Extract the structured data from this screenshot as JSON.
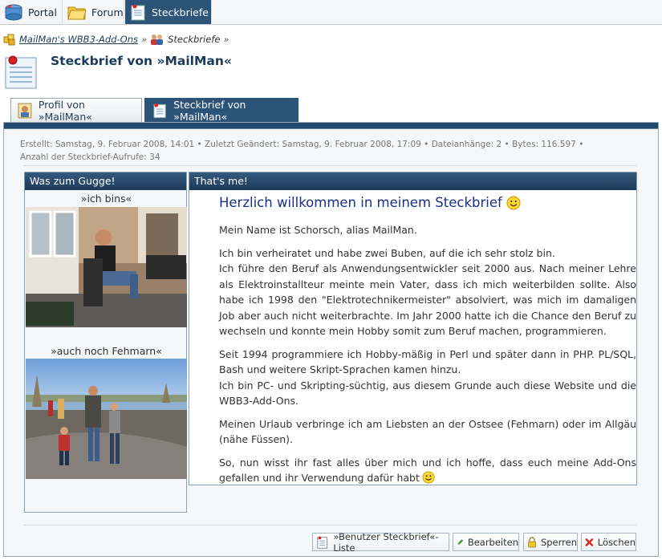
{
  "nav": {
    "tabs": [
      {
        "label": "Portal",
        "icon": "portal-icon"
      },
      {
        "label": "Forum",
        "icon": "forum-folder-icon"
      },
      {
        "label": "Steckbriefe",
        "icon": "steckbrief-icon",
        "active": true
      }
    ]
  },
  "breadcrumb": {
    "items": [
      {
        "label": "MailMan's WBB3-Add-Ons",
        "icon": "addons-icon",
        "link": true
      },
      {
        "label": "Steckbriefe",
        "icon": "users-icon",
        "link": false
      }
    ],
    "separator": "»"
  },
  "header": {
    "title": "Steckbrief von »MailMan«",
    "icon": "steckbrief-large-icon"
  },
  "subtabs": [
    {
      "label": "Profil von »MailMan«",
      "icon": "profile-icon",
      "active": false
    },
    {
      "label": "Steckbrief von »MailMan«",
      "icon": "steckbrief-icon",
      "active": true
    }
  ],
  "meta": "Erstellt: Samstag, 9. Februar 2008, 14:01 • Zuletzt Geändert: Samstag, 9. Februar 2008, 17:09 • Dateianhänge: 2 • Bytes: 116.597 • Anzahl der Steckbrief-Aufrufe: 34",
  "left_panel": {
    "title": "Was zum Gugge!",
    "captions": [
      "»ich bins«",
      "»auch noch Fehmarn«"
    ]
  },
  "right_panel": {
    "title": "That's me!",
    "heading": "Herzlich willkommen in meinem Steckbrief",
    "paragraphs": [
      "Mein Name ist Schorsch, alias MailMan.",
      "Ich bin verheiratet und habe zwei Buben, auf die ich sehr stolz bin.",
      "Ich führe den Beruf als Anwendungsentwickler seit 2000 aus. Nach meiner Lehre als Elektroinstallteur meinte mein Vater, dass ich mich weiterbilden sollte. Also habe ich 1998 den \"Elektrotechnikermeister\" absolviert, was mich im damaligen Job aber auch nicht weiterbrachte. Im Jahr 2000 hatte ich die Chance den Beruf zu wechseln und konnte mein Hobby somit zum Beruf machen, programmieren.",
      "Seit 1994 programmiere ich Hobby-mäßig in Perl und später dann in PHP. PL/SQL, Bash und weitere Skript-Sprachen kamen hinzu.",
      "Ich bin PC- und Skripting-süchtig, aus diesem Grunde auch diese Website und die WBB3-Add-Ons.",
      "Meinen Urlaub verbringe ich am Liebsten an der Ostsee (Fehmarn) oder im Allgäu (nähe Füssen).",
      "So, nun wisst ihr fast alles über mich und ich hoffe, dass euch meine Add-Ons gefallen und ihr Verwendung dafür habt"
    ]
  },
  "buttons": [
    {
      "label": "»Benutzer Steckbrief«-Liste",
      "icon": "list-icon"
    },
    {
      "label": "Bearbeiten",
      "icon": "pencil-icon"
    },
    {
      "label": "Sperren",
      "icon": "lock-icon"
    },
    {
      "label": "Löschen",
      "icon": "delete-x-icon"
    }
  ]
}
